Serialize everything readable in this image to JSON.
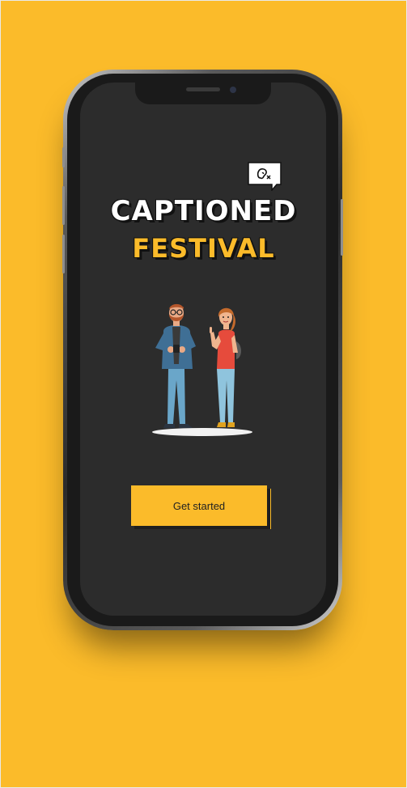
{
  "app": {
    "title_line1": "CAPTIONED",
    "title_line2": "FESTIVAL",
    "cta_label": "Get started",
    "icons": {
      "badge": "hearing-caption-icon",
      "illustration": "festival-goers-illustration"
    }
  },
  "colors": {
    "background": "#FBBB2A",
    "screen": "#2C2C2C",
    "accent": "#FBBB2A",
    "title_white": "#FFFFFF"
  }
}
